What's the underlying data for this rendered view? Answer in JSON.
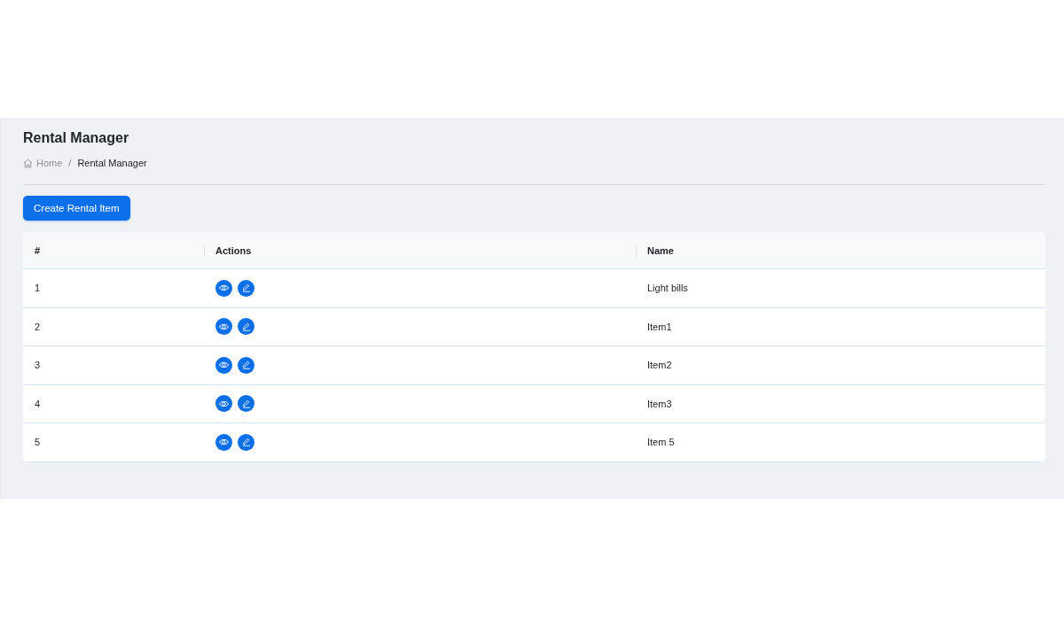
{
  "page": {
    "title": "Rental Manager",
    "breadcrumb": [
      {
        "label": "Home",
        "kind": "home"
      },
      {
        "label": "/",
        "kind": "separator"
      },
      {
        "label": "Rental Manager",
        "kind": "current"
      }
    ]
  },
  "create_button": "Create Rental Item",
  "table": {
    "columns": [
      "#",
      "Actions",
      "Name"
    ],
    "rows": [
      {
        "number": "1",
        "name": "Light bills"
      },
      {
        "number": "2",
        "name": "Item1"
      },
      {
        "number": "3",
        "name": "Item2"
      },
      {
        "number": "4",
        "name": "Item3"
      },
      {
        "number": "5",
        "name": "Item 5"
      }
    ]
  }
}
